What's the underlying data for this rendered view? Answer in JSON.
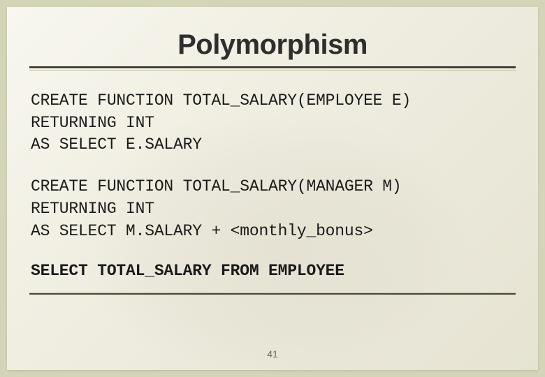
{
  "slide": {
    "title": "Polymorphism",
    "code_block_1": "CREATE FUNCTION TOTAL_SALARY(EMPLOYEE E)\nRETURNING INT\nAS SELECT E.SALARY",
    "code_block_2": "CREATE FUNCTION TOTAL_SALARY(MANAGER M)\nRETURNING INT\nAS SELECT M.SALARY + <monthly_bonus>",
    "query": "SELECT TOTAL_SALARY FROM EMPLOYEE",
    "page_number": "41"
  }
}
